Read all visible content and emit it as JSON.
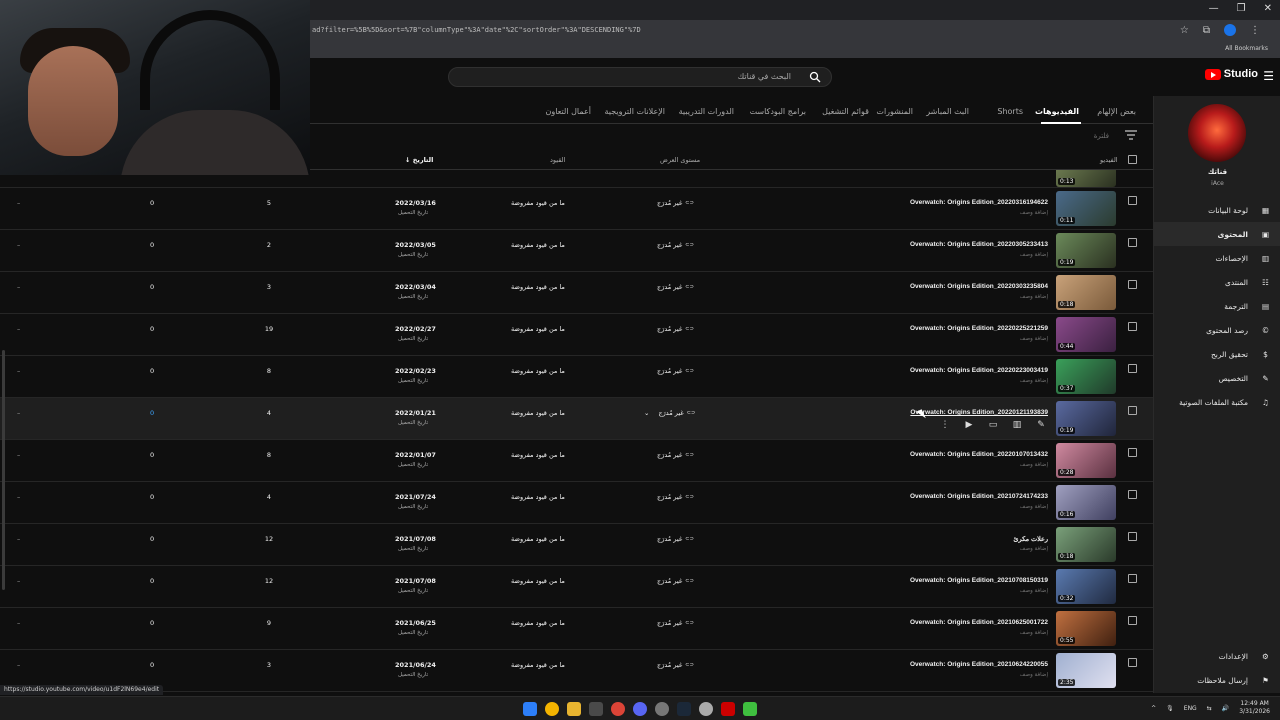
{
  "browser": {
    "url": "ad?filter=%5B%5D&sort=%7B\"columnType\"%3A\"date\"%2C\"sortOrder\"%3A\"DESCENDING\"%7D",
    "bookmarks_label": "All Bookmarks",
    "profile_initials": "m",
    "status_url": "https://studio.youtube.com/video/u1dF2lN69e4/edit"
  },
  "header": {
    "search_placeholder": "البحث في قناتك",
    "logo_text": "Studio"
  },
  "channel": {
    "name": "قناتك",
    "handle": "iAce"
  },
  "sidebar": {
    "items": [
      {
        "label": "لوحة البيانات",
        "icon": "dashboard-icon"
      },
      {
        "label": "المحتوى",
        "icon": "content-icon",
        "active": true
      },
      {
        "label": "الإحصاءات",
        "icon": "analytics-icon"
      },
      {
        "label": "المنتدى",
        "icon": "community-icon"
      },
      {
        "label": "الترجمة",
        "icon": "subtitles-icon"
      },
      {
        "label": "رصد المحتوى",
        "icon": "copyright-icon"
      },
      {
        "label": "تحقيق الربح",
        "icon": "monetization-icon"
      },
      {
        "label": "التخصيص",
        "icon": "customization-icon"
      },
      {
        "label": "مكتبة الملفات الصوتية",
        "icon": "audio-library-icon"
      }
    ],
    "bottom": [
      {
        "label": "الإعدادات",
        "icon": "settings-icon"
      },
      {
        "label": "إرسال ملاحظات",
        "icon": "feedback-icon"
      }
    ]
  },
  "tabs": [
    {
      "label": "بعض الإلهام"
    },
    {
      "label": "الفيديوهات",
      "active": true
    },
    {
      "label": "Shorts"
    },
    {
      "label": "البث المباشر"
    },
    {
      "label": "المنشورات"
    },
    {
      "label": "قوائم التشغيل"
    },
    {
      "label": "برامج البودكاست"
    },
    {
      "label": "الدورات التدريبية"
    },
    {
      "label": "الإعلانات الترويجية"
    },
    {
      "label": "أعمال التعاون"
    }
  ],
  "filter": {
    "placeholder": "فلترة"
  },
  "columns": {
    "video": "الفيديو",
    "visibility": "مستوى العرض",
    "restrictions": "القيود",
    "date": "التاريخ"
  },
  "partial_row": {
    "duration": "0:13"
  },
  "rows": [
    {
      "title": "Overwatch: Origins Edition_20220316194622",
      "desc": "إضافة وصف",
      "duration": "0:11",
      "visibility": "غير مُدرَج",
      "restrictions": "ما من قيود مفروضة",
      "date": "2022/03/16",
      "date_sub": "تاريخ التحميل",
      "views": "5",
      "comments": "0",
      "likes": "–",
      "thumb": [
        "#4a6a8a",
        "#2b3b2e"
      ]
    },
    {
      "title": "Overwatch: Origins Edition_20220305233413",
      "desc": "إضافة وصف",
      "duration": "0:19",
      "visibility": "غير مُدرَج",
      "restrictions": "ما من قيود مفروضة",
      "date": "2022/03/05",
      "date_sub": "تاريخ التحميل",
      "views": "2",
      "comments": "0",
      "likes": "–",
      "thumb": [
        "#6b8a5a",
        "#2a3020"
      ]
    },
    {
      "title": "Overwatch: Origins Edition_20220303235804",
      "desc": "إضافة وصف",
      "duration": "0:18",
      "visibility": "غير مُدرَج",
      "restrictions": "ما من قيود مفروضة",
      "date": "2022/03/04",
      "date_sub": "تاريخ التحميل",
      "views": "3",
      "comments": "0",
      "likes": "–",
      "thumb": [
        "#c9a27a",
        "#7a5a3a"
      ]
    },
    {
      "title": "Overwatch: Origins Edition_20220225221259",
      "desc": "إضافة وصف",
      "duration": "0:44",
      "visibility": "غير مُدرَج",
      "restrictions": "ما من قيود مفروضة",
      "date": "2022/02/27",
      "date_sub": "تاريخ التحميل",
      "views": "19",
      "comments": "0",
      "likes": "–",
      "thumb": [
        "#8a4a8a",
        "#3a2040"
      ]
    },
    {
      "title": "Overwatch: Origins Edition_20220223003419",
      "desc": "إضافة وصف",
      "duration": "0:37",
      "visibility": "غير مُدرَج",
      "restrictions": "ما من قيود مفروضة",
      "date": "2022/02/23",
      "date_sub": "تاريخ التحميل",
      "views": "8",
      "comments": "0",
      "likes": "–",
      "thumb": [
        "#3aa05a",
        "#203a2a"
      ]
    },
    {
      "title": "Overwatch: Origins Edition_20220121193839",
      "desc": "",
      "duration": "0:19",
      "visibility": "غير مُدرَج",
      "restrictions": "ما من قيود مفروضة",
      "date": "2022/01/21",
      "date_sub": "تاريخ التحميل",
      "views": "4",
      "comments": "0",
      "likes": "–",
      "thumb": [
        "#5a6aa0",
        "#20253a"
      ],
      "hover": true
    },
    {
      "title": "Overwatch: Origins Edition_20220107013432",
      "desc": "إضافة وصف",
      "duration": "0:28",
      "visibility": "غير مُدرَج",
      "restrictions": "ما من قيود مفروضة",
      "date": "2022/01/07",
      "date_sub": "تاريخ التحميل",
      "views": "8",
      "comments": "0",
      "likes": "–",
      "thumb": [
        "#d08aa0",
        "#5a3040"
      ]
    },
    {
      "title": "Overwatch: Origins Edition_20210724174233",
      "desc": "إضافة وصف",
      "duration": "0:16",
      "visibility": "غير مُدرَج",
      "restrictions": "ما من قيود مفروضة",
      "date": "2021/07/24",
      "date_sub": "تاريخ التحميل",
      "views": "4",
      "comments": "0",
      "likes": "–",
      "thumb": [
        "#a0a0c0",
        "#404060"
      ]
    },
    {
      "title": "رعلات مكرئ",
      "desc": "إضافة وصف",
      "duration": "0:18",
      "visibility": "غير مُدرَج",
      "restrictions": "ما من قيود مفروضة",
      "date": "2021/07/08",
      "date_sub": "تاريخ التحميل",
      "views": "12",
      "comments": "0",
      "likes": "–",
      "thumb": [
        "#7aa07a",
        "#2a3a2a"
      ]
    },
    {
      "title": "Overwatch: Origins Edition_20210708150319",
      "desc": "إضافة وصف",
      "duration": "0:32",
      "visibility": "غير مُدرَج",
      "restrictions": "ما من قيود مفروضة",
      "date": "2021/07/08",
      "date_sub": "تاريخ التحميل",
      "views": "12",
      "comments": "0",
      "likes": "–",
      "thumb": [
        "#5a7ab0",
        "#202a40"
      ]
    },
    {
      "title": "Overwatch: Origins Edition_20210625001722",
      "desc": "إضافة وصف",
      "duration": "0:55",
      "visibility": "غير مُدرَج",
      "restrictions": "ما من قيود مفروضة",
      "date": "2021/06/25",
      "date_sub": "تاريخ التحميل",
      "views": "9",
      "comments": "0",
      "likes": "–",
      "thumb": [
        "#c07040",
        "#402010"
      ]
    },
    {
      "title": "Overwatch: Origins Edition_20210624220055",
      "desc": "إضافة وصف",
      "duration": "2:35",
      "visibility": "غير مُدرَج",
      "restrictions": "ما من قيود مفروضة",
      "date": "2021/06/24",
      "date_sub": "تاريخ التحميل",
      "views": "3",
      "comments": "0",
      "likes": "–",
      "thumb": [
        "#a0b0d0",
        "#e0e0f0"
      ]
    }
  ],
  "taskbar": {
    "lang": "ENG",
    "time": "12:49 AM",
    "date": "3/31/2026"
  },
  "colors": {
    "accent_red": "#ff0000",
    "link_blue": "#3ea6ff",
    "bg": "#0f0f0f",
    "sidebar_bg": "#1f1f1f"
  }
}
